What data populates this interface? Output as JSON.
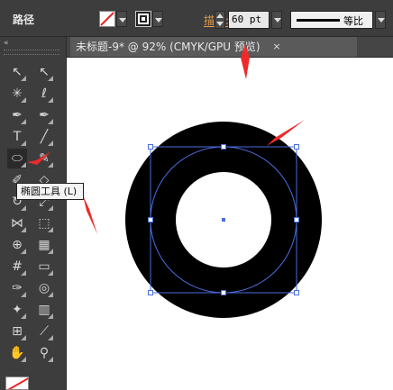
{
  "control_bar": {
    "title": "路径",
    "fill_swatch": "none-swatch-icon",
    "stroke_swatch": "stroke-swatch-icon",
    "stroke_label": "描边",
    "stroke_colon": ":",
    "stroke_weight": "60 pt",
    "profile_label": "等比"
  },
  "document_tab": {
    "title": "未标题-9* @ 92% (CMYK/GPU 预览)",
    "close": "×"
  },
  "toolbar": {
    "collapse": "«",
    "tools": [
      {
        "name": "selection-tool-icon",
        "glyph": "↖"
      },
      {
        "name": "direct-selection-tool-icon",
        "glyph": "↖"
      },
      {
        "name": "magic-wand-tool-icon",
        "glyph": "✳"
      },
      {
        "name": "lasso-tool-icon",
        "glyph": "ℓ"
      },
      {
        "name": "pen-tool-icon",
        "glyph": "✒"
      },
      {
        "name": "curvature-tool-icon",
        "glyph": "✒"
      },
      {
        "name": "type-tool-icon",
        "glyph": "T"
      },
      {
        "name": "line-tool-icon",
        "glyph": "╱"
      },
      {
        "name": "ellipse-tool-icon",
        "glyph": "⬭"
      },
      {
        "name": "paintbrush-tool-icon",
        "glyph": "✎"
      },
      {
        "name": "pencil-tool-icon",
        "glyph": "✐"
      },
      {
        "name": "eraser-tool-icon",
        "glyph": "◇"
      },
      {
        "name": "rotate-tool-icon",
        "glyph": "↻"
      },
      {
        "name": "scale-tool-icon",
        "glyph": "⤢"
      },
      {
        "name": "width-tool-icon",
        "glyph": "⋈"
      },
      {
        "name": "free-transform-tool-icon",
        "glyph": "⬚"
      },
      {
        "name": "shape-builder-tool-icon",
        "glyph": "⊕"
      },
      {
        "name": "perspective-grid-tool-icon",
        "glyph": "▦"
      },
      {
        "name": "mesh-tool-icon",
        "glyph": "#"
      },
      {
        "name": "gradient-tool-icon",
        "glyph": "▭"
      },
      {
        "name": "eyedropper-tool-icon",
        "glyph": "✑"
      },
      {
        "name": "blend-tool-icon",
        "glyph": "◎"
      },
      {
        "name": "symbol-sprayer-tool-icon",
        "glyph": "✦"
      },
      {
        "name": "column-graph-tool-icon",
        "glyph": "▥"
      },
      {
        "name": "artboard-tool-icon",
        "glyph": "⊞"
      },
      {
        "name": "slice-tool-icon",
        "glyph": "⟋"
      },
      {
        "name": "hand-tool-icon",
        "glyph": "✋"
      },
      {
        "name": "zoom-tool-icon",
        "glyph": "⚲"
      }
    ],
    "selected_tool": "ellipse-tool-icon"
  },
  "tooltip": {
    "text": "椭圆工具 (L)"
  },
  "artwork": {
    "ring_color": "#000000",
    "selection_color": "#4a6ee0",
    "annotation_arrow_color": "#ee2a2a"
  }
}
